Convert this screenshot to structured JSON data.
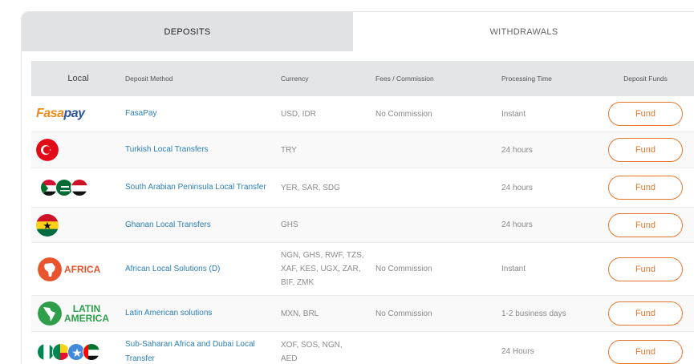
{
  "tabs": {
    "deposits": "DEPOSITS",
    "withdrawals": "WITHDRAWALS"
  },
  "header": {
    "local": "Local",
    "method": "Deposit Method",
    "currency": "Currency",
    "fees": "Fees / Commission",
    "time": "Processing Time",
    "fund": "Deposit Funds"
  },
  "logos": {
    "fasapay_a": "Fasa",
    "fasapay_b": "pay",
    "africa": "AFRICA",
    "latin_1": "LATIN",
    "latin_2": "AMERICA"
  },
  "rows": [
    {
      "method": "FasaPay",
      "currency": "USD, IDR",
      "fees": "No Commission",
      "time": "Instant",
      "fund": "Fund",
      "icon": "fasapay-logo"
    },
    {
      "method": "Turkish Local Transfers",
      "currency": "TRY",
      "fees": "",
      "time": "24 hours",
      "fund": "Fund",
      "icon": "turkey-flag-icon"
    },
    {
      "method": "South Arabian Peninsula Local Transfer",
      "currency": "YER, SAR, SDG",
      "fees": "",
      "time": "24 hours",
      "fund": "Fund",
      "icon": "arabian-flags-icon"
    },
    {
      "method": "Ghanan Local Transfers",
      "currency": "GHS",
      "fees": "",
      "time": "24 hours",
      "fund": "Fund",
      "icon": "ghana-flag-icon"
    },
    {
      "method": "African Local Solutions (D)",
      "currency": "NGN, GHS, RWF, TZS, XAF, KES, UGX, ZAR, BIF, ZMK",
      "fees": "No Commission",
      "time": "Instant",
      "fund": "Fund",
      "icon": "africa-logo"
    },
    {
      "method": "Latin American solutions",
      "currency": "MXN, BRL",
      "fees": "No Commission",
      "time": "1-2 business days",
      "fund": "Fund",
      "icon": "latin-america-logo"
    },
    {
      "method": "Sub-Saharan Africa and Dubai Local Transfer",
      "currency": "XOF, SOS, NGN, AED",
      "fees": "",
      "time": "24 Hours",
      "fund": "Fund",
      "icon": "sub-saharan-flags-icon"
    }
  ],
  "colors": {
    "accent": "#e8762e",
    "link": "#2b7fb8",
    "header_bg": "#e4e5e6"
  }
}
